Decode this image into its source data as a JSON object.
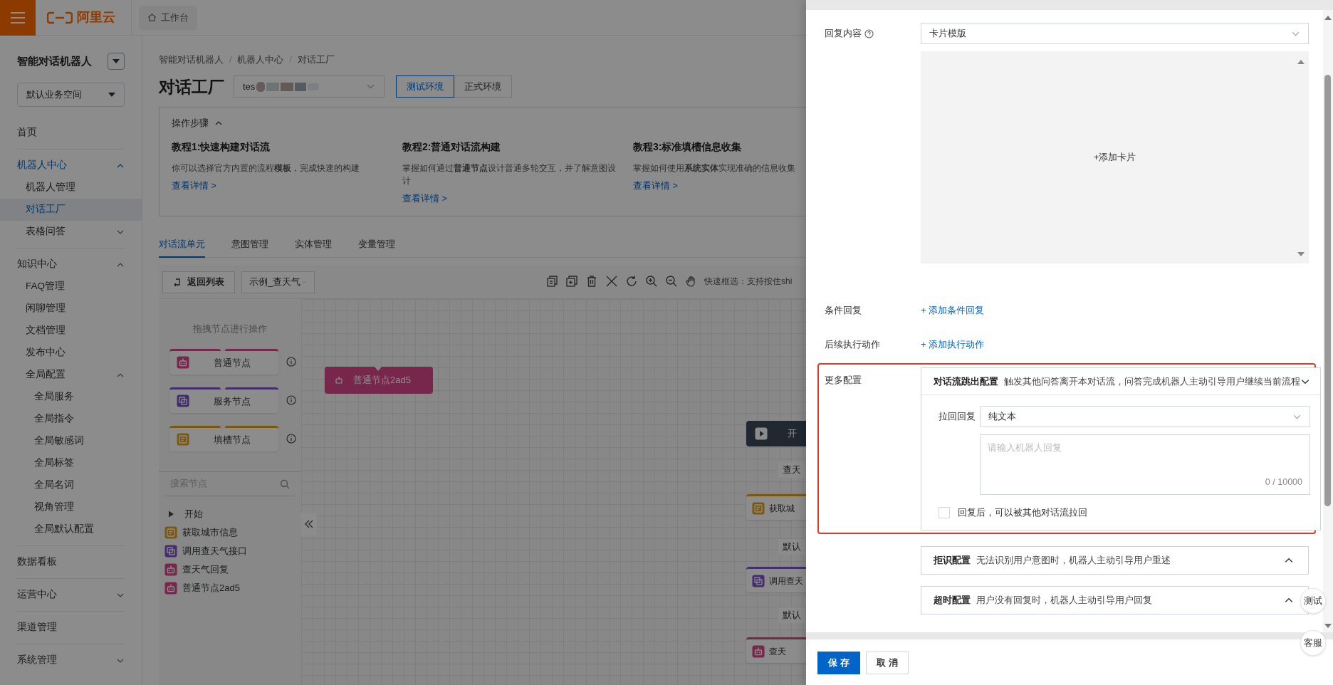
{
  "top_bar": {
    "logo": "阿里云",
    "tab": "工作台"
  },
  "sidebar": {
    "title": "智能对话机器人",
    "workspace": "默认业务空间",
    "sections": [
      {
        "label": "首页",
        "kind": "link",
        "selected": false
      },
      {
        "label": "机器人中心",
        "kind": "group",
        "expanded": true,
        "selected": false,
        "children": [
          {
            "label": "机器人管理",
            "kind": "link",
            "selected": false
          },
          {
            "label": "对话工厂",
            "kind": "link",
            "selected": true
          },
          {
            "label": "表格问答",
            "kind": "group",
            "expanded": false,
            "selected": false
          }
        ]
      },
      {
        "label": "知识中心",
        "kind": "group",
        "expanded": true,
        "selected": false,
        "children": [
          {
            "label": "FAQ管理",
            "kind": "link",
            "selected": false
          },
          {
            "label": "闲聊管理",
            "kind": "link",
            "selected": false
          },
          {
            "label": "文档管理",
            "kind": "link",
            "selected": false
          },
          {
            "label": "发布中心",
            "kind": "link",
            "selected": false
          },
          {
            "label": "全局配置",
            "kind": "group",
            "expanded": true,
            "selected": false,
            "children": [
              {
                "label": "全局服务",
                "kind": "link",
                "selected": false
              },
              {
                "label": "全局指令",
                "kind": "link",
                "selected": false
              },
              {
                "label": "全局敏感词",
                "kind": "link",
                "selected": false
              },
              {
                "label": "全局标签",
                "kind": "link",
                "selected": false
              },
              {
                "label": "全局名词",
                "kind": "link",
                "selected": false
              },
              {
                "label": "视角管理",
                "kind": "link",
                "selected": false
              },
              {
                "label": "全局默认配置",
                "kind": "link",
                "selected": false
              }
            ]
          }
        ]
      },
      {
        "label": "数据看板",
        "kind": "link",
        "selected": false
      },
      {
        "label": "运营中心",
        "kind": "group",
        "expanded": false,
        "selected": false
      },
      {
        "label": "渠道管理",
        "kind": "link",
        "selected": false
      },
      {
        "label": "系统管理",
        "kind": "group",
        "expanded": false,
        "selected": false
      }
    ]
  },
  "breadcrumb": [
    "智能对话机器人",
    "机器人中心",
    "对话工厂"
  ],
  "breadcrumb_separator": "/",
  "page_title": "对话工厂",
  "bot_select": {
    "value": "tes"
  },
  "env_buttons": [
    {
      "label": "测试环境",
      "selected": true
    },
    {
      "label": "正式环境",
      "selected": false
    }
  ],
  "steps": {
    "title": "操作步骤",
    "expanded": true,
    "tutorials": [
      {
        "title": "教程1:快速构建对话流",
        "text": "你可以选择官方内置的流程**模板**，完成快速的构建",
        "link": "查看详情 >"
      },
      {
        "title": "教程2:普通对话流构建",
        "text": "掌握如何通过**普通节点**设计普通多轮交互，并了解意图设计",
        "link": "查看详情 >"
      },
      {
        "title": "教程3:标准填槽信息收集",
        "text": "掌握如何使用**系统实体**实现准确的信息收集",
        "link": "查看详情 >"
      }
    ]
  },
  "tabs": [
    {
      "label": "对话流单元",
      "selected": true
    },
    {
      "label": "意图管理",
      "selected": false
    },
    {
      "label": "实体管理",
      "selected": false
    },
    {
      "label": "变量管理",
      "selected": false
    }
  ],
  "toolbar": {
    "back": "返回列表",
    "flow": "示例_查天气",
    "hint": "快速框选：支持按住shi"
  },
  "palette": {
    "hint": "拖拽节点进行操作",
    "types": [
      {
        "label": "普通节点",
        "kind": "normal"
      },
      {
        "label": "服务节点",
        "kind": "service"
      },
      {
        "label": "填槽节点",
        "kind": "slot"
      }
    ],
    "search_placeholder": "搜索节点",
    "nodes": [
      {
        "label": "开始",
        "kind": "start"
      },
      {
        "label": "获取城市信息",
        "kind": "slot"
      },
      {
        "label": "调用查天气接口",
        "kind": "service"
      },
      {
        "label": "查天气回复",
        "kind": "normal"
      },
      {
        "label": "普通节点2ad5",
        "kind": "normal"
      }
    ]
  },
  "canvas": {
    "items": [
      {
        "label": "普通节点2ad5",
        "kind": "selected_node"
      },
      {
        "label": "开",
        "kind": "start"
      },
      {
        "label": "查天",
        "kind": "edge_label"
      },
      {
        "label": "获取城",
        "kind": "slot"
      },
      {
        "label": "默认",
        "kind": "edge_label"
      },
      {
        "label": "调用查天",
        "kind": "service"
      },
      {
        "label": "默认",
        "kind": "edge_label"
      },
      {
        "label": "查天",
        "kind": "normal"
      }
    ]
  },
  "drawer": {
    "reply": {
      "label": "回复内容",
      "value": "卡片模版",
      "add_card": "+添加卡片"
    },
    "conditional": {
      "label": "条件回复",
      "link": "+ 添加条件回复"
    },
    "actions": {
      "label": "后续执行动作",
      "link": "+ 添加执行动作"
    },
    "more": {
      "label": "更多配置",
      "highlighted": true,
      "panels": [
        {
          "title": "对话流跳出配置",
          "desc": "触发其他问答离开本对话流，问答完成机器人主动引导用户继续当前流程",
          "expanded": true,
          "body": {
            "label": "拉回回复",
            "type": "纯文本",
            "placeholder": "请输入机器人回复",
            "counter": "0 / 10000",
            "checkbox": {
              "label": "回复后，可以被其他对话流拉回",
              "checked": false
            }
          }
        },
        {
          "title": "拒识配置",
          "desc": "无法识别用户意图时，机器人主动引导用户重述",
          "expanded": false
        },
        {
          "title": "超时配置",
          "desc": "用户没有回复时，机器人主动引导用户回复",
          "expanded": false
        }
      ]
    },
    "footer": [
      {
        "label": "保 存",
        "kind": "primary"
      },
      {
        "label": "取 消",
        "kind": "default"
      }
    ]
  },
  "float_buttons": [
    "测试",
    "客服"
  ]
}
